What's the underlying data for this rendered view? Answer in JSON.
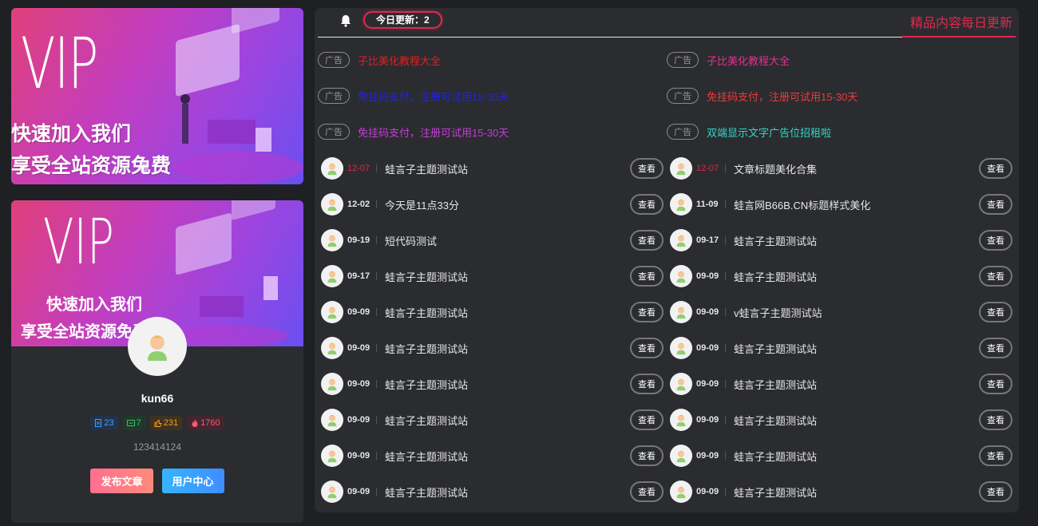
{
  "banner_top": {
    "vip": "VIP",
    "line1": "快速加入我们",
    "line2": "享受全站资源免费"
  },
  "profile": {
    "banner": {
      "vip": "VIP",
      "line1": "快速加入我们",
      "line2": "享受全站资源免费"
    },
    "username": "kun66",
    "stats": {
      "posts": "23",
      "comments": "7",
      "likes": "231",
      "hot": "1760"
    },
    "description": "123414124",
    "publish_label": "发布文章",
    "usercenter_label": "用户中心"
  },
  "header": {
    "update_label": "今日更新：2",
    "slogan": "精品内容每日更新"
  },
  "ads": [
    {
      "tag": "广告",
      "text": "子比美化教程大全",
      "color": "#e02020"
    },
    {
      "tag": "广告",
      "text": "子比美化教程大全",
      "color": "#e0328e"
    },
    {
      "tag": "广告",
      "text": "免挂码支付，注册可试用15-30天",
      "color": "#2424d8"
    },
    {
      "tag": "广告",
      "text": "免挂码支付，注册可试用15-30天",
      "color": "#ea3c3c"
    },
    {
      "tag": "广告",
      "text": "免挂码支付，注册可试用15-30天",
      "color": "#c43cd8"
    },
    {
      "tag": "广告",
      "text": "双端显示文字广告位招租啦",
      "color": "#2fd8c8"
    }
  ],
  "posts_left": [
    {
      "date": "12-07",
      "title": "蛙言子主题测试站",
      "hot": true
    },
    {
      "date": "12-02",
      "title": "今天是11点33分",
      "hot": false
    },
    {
      "date": "09-19",
      "title": "短代码测试",
      "hot": false
    },
    {
      "date": "09-17",
      "title": "蛙言子主题测试站",
      "hot": false
    },
    {
      "date": "09-09",
      "title": "蛙言子主题测试站",
      "hot": false
    },
    {
      "date": "09-09",
      "title": "蛙言子主题测试站",
      "hot": false
    },
    {
      "date": "09-09",
      "title": "蛙言子主题测试站",
      "hot": false
    },
    {
      "date": "09-09",
      "title": "蛙言子主题测试站",
      "hot": false
    },
    {
      "date": "09-09",
      "title": "蛙言子主题测试站",
      "hot": false
    },
    {
      "date": "09-09",
      "title": "蛙言子主题测试站",
      "hot": false
    }
  ],
  "posts_right": [
    {
      "date": "12-07",
      "title": "文章标题美化合集",
      "hot": true
    },
    {
      "date": "11-09",
      "title": "蛙言网B66B.CN标题样式美化",
      "hot": false
    },
    {
      "date": "09-17",
      "title": "蛙言子主题测试站",
      "hot": false
    },
    {
      "date": "09-09",
      "title": "蛙言子主题测试站",
      "hot": false
    },
    {
      "date": "09-09",
      "title": "v蛙言子主题测试站",
      "hot": false
    },
    {
      "date": "09-09",
      "title": "蛙言子主题测试站",
      "hot": false
    },
    {
      "date": "09-09",
      "title": "蛙言子主题测试站",
      "hot": false
    },
    {
      "date": "09-09",
      "title": "蛙言子主题测试站",
      "hot": false
    },
    {
      "date": "09-09",
      "title": "蛙言子主题测试站",
      "hot": false
    },
    {
      "date": "09-09",
      "title": "蛙言子主题测试站",
      "hot": false
    }
  ],
  "view_label": "查看"
}
